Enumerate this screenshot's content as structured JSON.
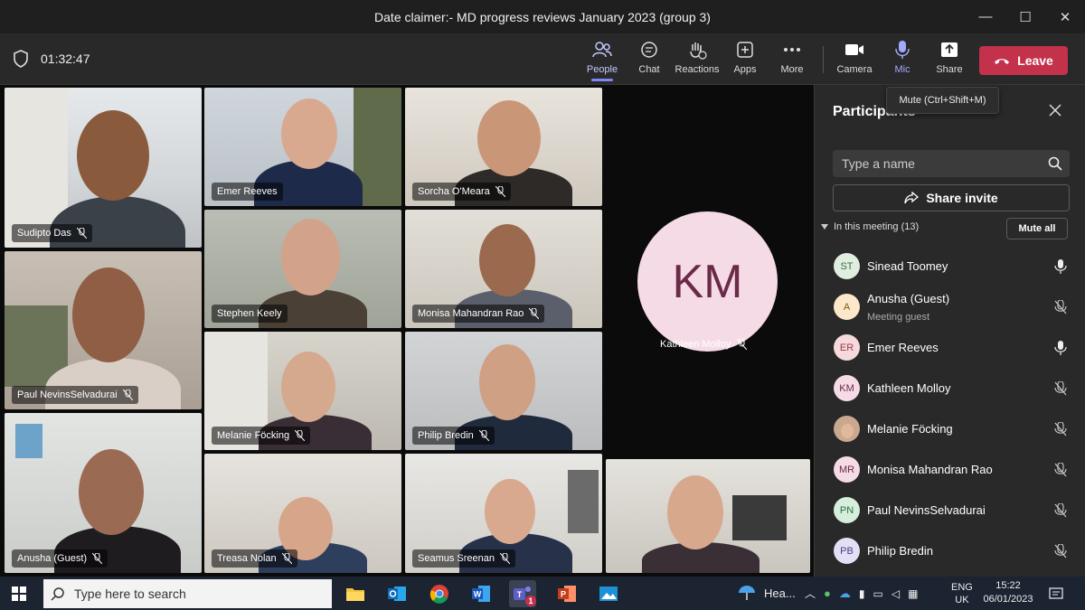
{
  "window": {
    "title": "Date claimer:- MD progress reviews January 2023 (group 3)",
    "minimize": "—",
    "maximize": "☐",
    "close": "✕"
  },
  "toolbar": {
    "timer": "01:32:47",
    "buttons": [
      {
        "label": "People",
        "icon": "people-icon"
      },
      {
        "label": "Chat",
        "icon": "chat-icon"
      },
      {
        "label": "Reactions",
        "icon": "reactions-icon"
      },
      {
        "label": "Apps",
        "icon": "apps-icon"
      },
      {
        "label": "More",
        "icon": "more-icon"
      },
      {
        "label": "Camera",
        "icon": "camera-icon"
      },
      {
        "label": "Mic",
        "icon": "mic-icon"
      },
      {
        "label": "Share",
        "icon": "share-icon"
      }
    ],
    "leave_label": "Leave"
  },
  "tooltip": "Mute (Ctrl+Shift+M)",
  "tiles": [
    {
      "name": "Sudipto Das",
      "muted": true
    },
    {
      "name": "Emer Reeves",
      "muted": false
    },
    {
      "name": "Sorcha O'Meara",
      "muted": true
    },
    {
      "name": "Stephen Keely",
      "muted": false
    },
    {
      "name": "Monisa Mahandran Rao",
      "muted": true
    },
    {
      "name": "Paul NevinsSelvadurai",
      "muted": true
    },
    {
      "name": "Melanie Föcking",
      "muted": true
    },
    {
      "name": "Philip Bredin",
      "muted": true
    },
    {
      "name": "Anusha (Guest)",
      "muted": true
    },
    {
      "name": "Treasa Nolan",
      "muted": true
    },
    {
      "name": "Seamus Sreenan",
      "muted": true
    },
    {
      "name": "",
      "muted": false
    }
  ],
  "featured": {
    "initials": "KM",
    "name": "Kathleen Molloy"
  },
  "panel": {
    "title": "Participants",
    "search_placeholder": "Type a name",
    "share_invite": "Share invite",
    "in_meeting": "In this meeting (13)",
    "mute_all": "Mute all",
    "participants": [
      {
        "initials": "ST",
        "name": "Sinead Toomey",
        "sub": "",
        "mic": "on",
        "bg": "#dfeee0",
        "fg": "#3f6a42"
      },
      {
        "initials": "A",
        "name": "Anusha (Guest)",
        "sub": "Meeting guest",
        "mic": "off",
        "bg": "#fbe7c9",
        "fg": "#8a5a12"
      },
      {
        "initials": "ER",
        "name": "Emer Reeves",
        "sub": "",
        "mic": "on",
        "bg": "#f6d9dc",
        "fg": "#9b3a46"
      },
      {
        "initials": "KM",
        "name": "Kathleen Molloy",
        "sub": "",
        "mic": "off",
        "bg": "#f5dbe6",
        "fg": "#6b2a48"
      },
      {
        "initials": "",
        "name": "Melanie Föcking",
        "sub": "",
        "mic": "off",
        "bg": "#c9a88e",
        "fg": "#5a3a26"
      },
      {
        "initials": "MR",
        "name": "Monisa Mahandran Rao",
        "sub": "",
        "mic": "off",
        "bg": "#f5dbe6",
        "fg": "#6b2a48"
      },
      {
        "initials": "PN",
        "name": "Paul NevinsSelvadurai",
        "sub": "",
        "mic": "off",
        "bg": "#d6eedc",
        "fg": "#2f6b41"
      },
      {
        "initials": "PB",
        "name": "Philip Bredin",
        "sub": "",
        "mic": "off",
        "bg": "#e3e0f5",
        "fg": "#4a3f8a"
      }
    ]
  },
  "taskbar": {
    "search_placeholder": "Type here to search",
    "weather": "Hea...",
    "lang_top": "ENG",
    "lang_bottom": "UK",
    "time": "15:22",
    "date": "06/01/2023",
    "teams_badge": "1"
  },
  "colors": {
    "accent": "#7f85f5",
    "leave": "#c4314b",
    "panel": "#292929",
    "stage": "#0b0b0b"
  }
}
